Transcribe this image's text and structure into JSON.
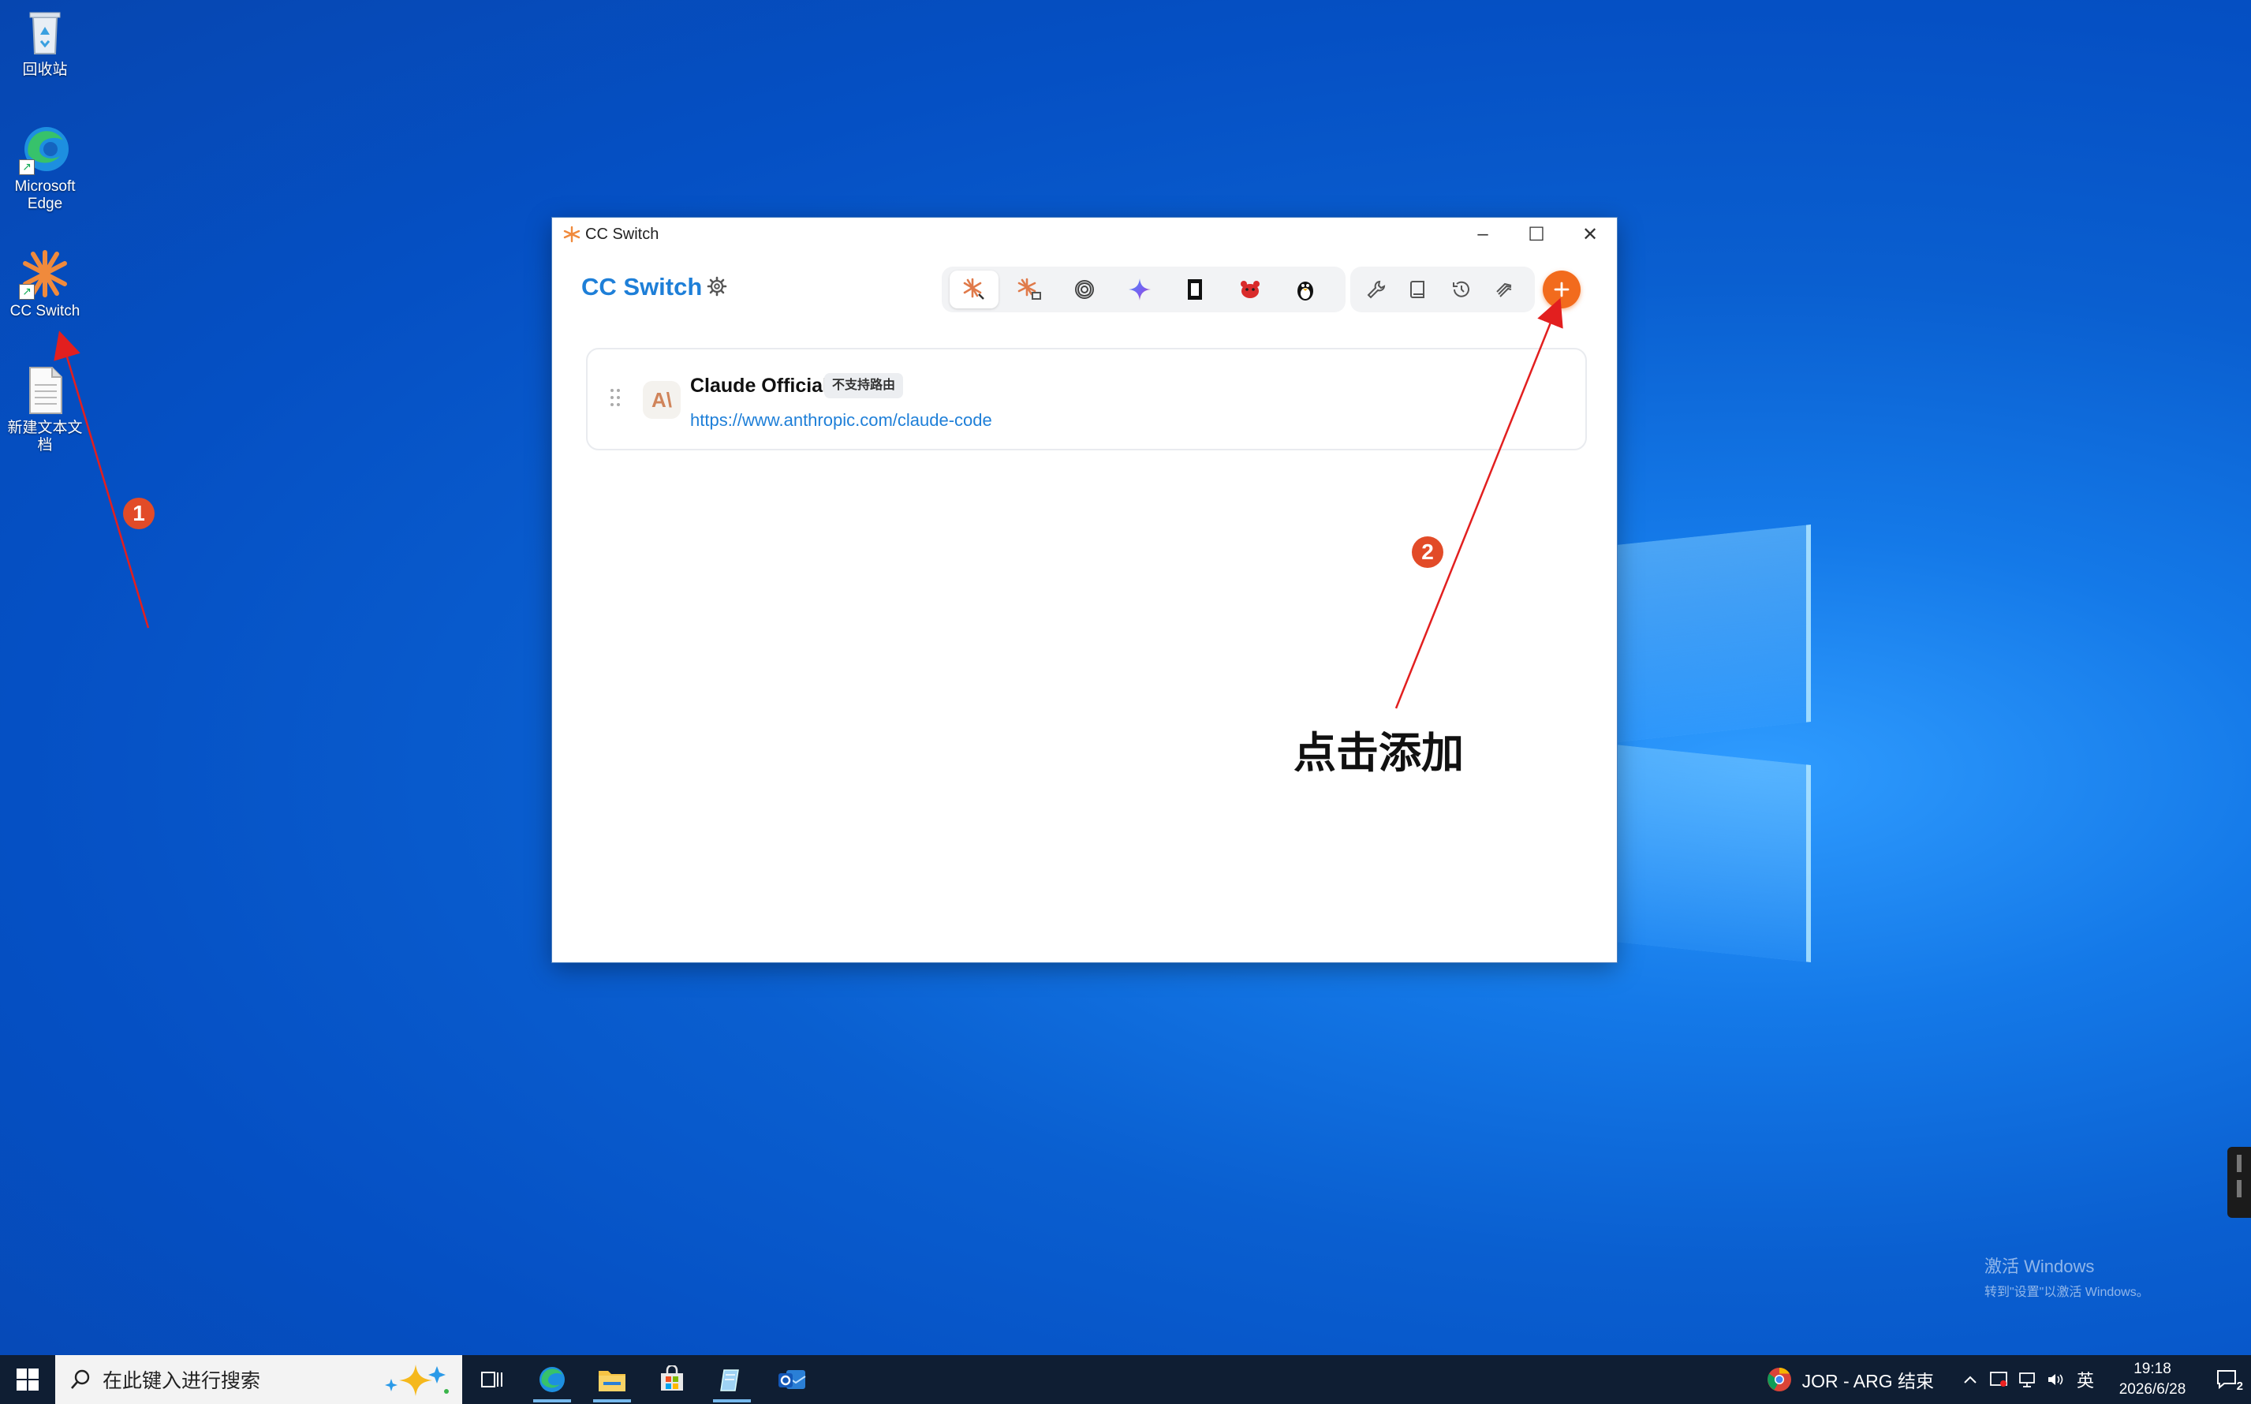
{
  "desktop": {
    "icons": [
      {
        "label": "回收站"
      },
      {
        "label": "Microsoft Edge"
      },
      {
        "label": "CC Switch"
      },
      {
        "label": "新建文本文档"
      }
    ],
    "watermark_line1": "激活 Windows",
    "watermark_line2": "转到\"设置\"以激活 Windows。"
  },
  "window": {
    "title": "CC Switch",
    "controls": {
      "minimize": "–",
      "maximize": "☐",
      "close": "✕"
    }
  },
  "app": {
    "brand": "CC Switch",
    "app_tabs": [
      "claude-code",
      "claude-desktop",
      "openai-codex",
      "gemini",
      "opencode",
      "openclaw",
      "qwen"
    ],
    "util_buttons": [
      "tools",
      "book",
      "history",
      "skills"
    ],
    "add_label": "+",
    "accent_color": "#f26b1d",
    "link_color": "#1e7fd8"
  },
  "providers": [
    {
      "name": "Claude Official",
      "logo": "A\\",
      "badge": "不支持路由",
      "url": "https://www.anthropic.com/claude-code"
    }
  ],
  "annotations": {
    "marker1": "1",
    "marker2": "2",
    "label": "点击添加",
    "color": "#e21f1f"
  },
  "taskbar": {
    "search_placeholder": "在此键入进行搜索",
    "weather": "JOR - ARG 结束",
    "ime": "英",
    "time": "19:18",
    "date": "2026/6/28",
    "notification_count": "2"
  }
}
